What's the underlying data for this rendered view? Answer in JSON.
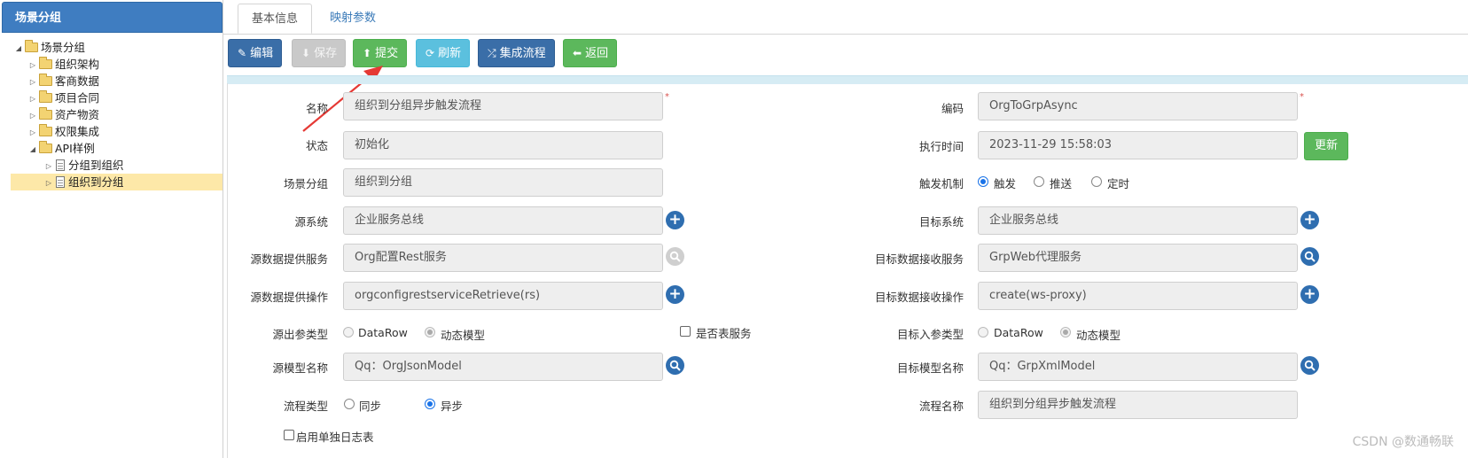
{
  "sidebar": {
    "title": "场景分组",
    "tree": [
      {
        "label": "场景分组"
      },
      {
        "label": "组织架构"
      },
      {
        "label": "客商数据"
      },
      {
        "label": "项目合同"
      },
      {
        "label": "资产物资"
      },
      {
        "label": "权限集成"
      },
      {
        "label": "API样例"
      },
      {
        "label": "分组到组织"
      },
      {
        "label": "组织到分组"
      }
    ]
  },
  "tabs": [
    {
      "label": "基本信息"
    },
    {
      "label": "映射参数"
    }
  ],
  "toolbar": {
    "edit": "编辑",
    "save": "保存",
    "submit": "提交",
    "refresh": "刷新",
    "flow": "集成流程",
    "back": "返回"
  },
  "form": {
    "name": {
      "label": "名称",
      "value": "组织到分组异步触发流程",
      "required": "*"
    },
    "code": {
      "label": "编码",
      "value": "OrgToGrpAsync",
      "required": "*"
    },
    "status": {
      "label": "状态",
      "value": "初始化"
    },
    "exec_time": {
      "label": "执行时间",
      "value": "2023-11-29 15:58:03",
      "button": "更新"
    },
    "scene_group": {
      "label": "场景分组",
      "value": "组织到分组"
    },
    "trigger": {
      "label": "触发机制",
      "options": [
        "触发",
        "推送",
        "定时"
      ],
      "selected": "触发"
    },
    "src_system": {
      "label": "源系统",
      "value": "企业服务总线"
    },
    "dst_system": {
      "label": "目标系统",
      "value": "企业服务总线"
    },
    "src_service": {
      "label": "源数据提供服务",
      "value": "Org配置Rest服务"
    },
    "dst_service": {
      "label": "目标数据接收服务",
      "value": "GrpWeb代理服务"
    },
    "src_op": {
      "label": "源数据提供操作",
      "value": "orgconfigrestserviceRetrieve(rs)"
    },
    "dst_op": {
      "label": "目标数据接收操作",
      "value": "create(ws-proxy)"
    },
    "src_param": {
      "label": "源出参类型",
      "options": [
        "DataRow",
        "动态模型"
      ],
      "selected": "动态模型"
    },
    "is_table_service": {
      "label": "是否表服务"
    },
    "dst_param": {
      "label": "目标入参类型",
      "options": [
        "DataRow",
        "动态模型"
      ],
      "selected": "动态模型"
    },
    "src_model": {
      "label": "源模型名称",
      "value": "Qq：OrgJsonModel"
    },
    "dst_model": {
      "label": "目标模型名称",
      "value": "Qq：GrpXmlModel"
    },
    "flow_type": {
      "label": "流程类型",
      "options": [
        "同步",
        "异步"
      ],
      "selected": "异步"
    },
    "flow_name": {
      "label": "流程名称",
      "value": "组织到分组异步触发流程"
    },
    "separate_log": {
      "label": "启用单独日志表"
    }
  },
  "watermark": "CSDN @数通畅联",
  "colors": {
    "primary": "#3a6ea8",
    "success": "#5cb85c",
    "info": "#5bc0de",
    "sidebar_header": "#3f7dc1",
    "selected_row": "#fde8a8"
  }
}
